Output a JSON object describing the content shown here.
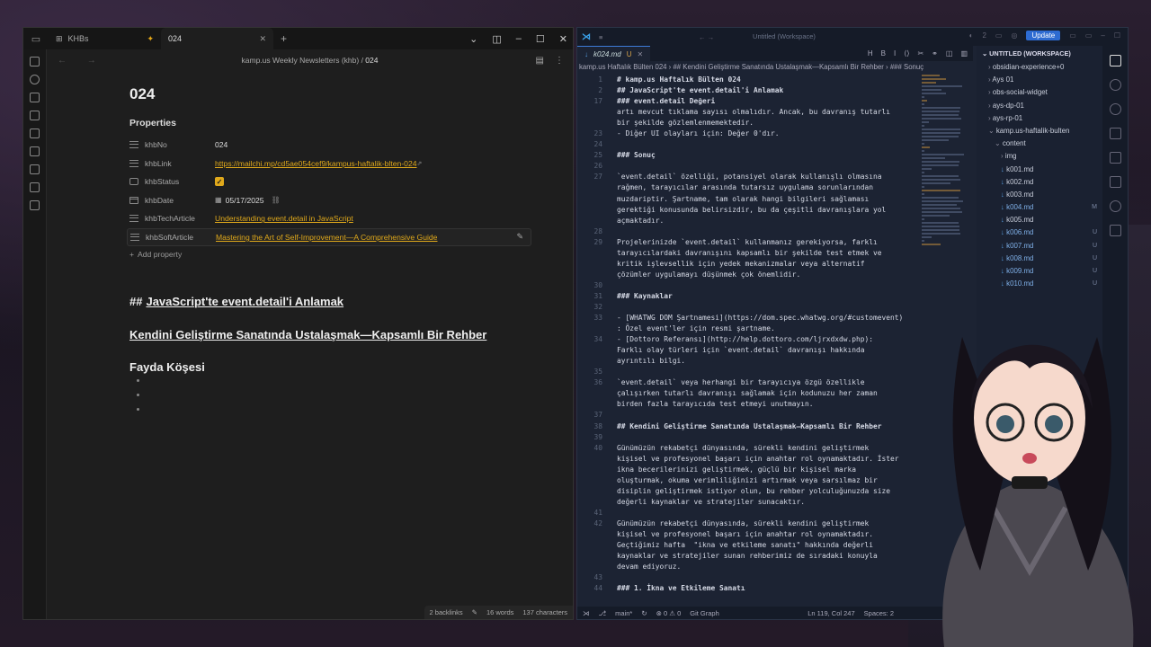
{
  "obsidian": {
    "tabs": [
      {
        "label": "KHBs",
        "icon": "grid-icon"
      },
      {
        "label": "024",
        "icon": "pin-icon"
      }
    ],
    "breadcrumb": {
      "path": "kamp.us Weekly Newsletters (khb)",
      "sep": " / ",
      "current": "024"
    },
    "note": {
      "title": "024",
      "properties_title": "Properties",
      "properties": [
        {
          "key": "khbNo",
          "value": "024",
          "type": "text"
        },
        {
          "key": "khbLink",
          "value": "https://mailchi.mp/cd5ae054cef9/kampus-haftalik-blten-024",
          "type": "link"
        },
        {
          "key": "khbStatus",
          "value": "checked",
          "type": "checkbox"
        },
        {
          "key": "khbDate",
          "value": "05/17/2025",
          "type": "date"
        },
        {
          "key": "khbTechArticle",
          "value": "Understanding event.detail in JavaScript",
          "type": "link"
        },
        {
          "key": "khbSoftArticle",
          "value": "Mastering the Art of Self-Improvement—A Comprehensive Guide",
          "type": "link"
        }
      ],
      "add_property": "Add property",
      "heading1_hash": "##",
      "heading1": "JavaScript'te event.detail'i Anlamak",
      "heading2": "Kendini Geliştirme Sanatında Ustalaşmak—Kapsamlı Bir Rehber",
      "heading3": "Fayda Köşesi"
    },
    "status": {
      "backlinks": "2 backlinks",
      "words": "16 words",
      "chars": "137 characters"
    }
  },
  "vscode": {
    "title": "Untitled (Workspace)",
    "tab": {
      "name": "k024.md",
      "flag": "U"
    },
    "breadcrumb": "kamp.us Haftalık Bülten 024 › ## Kendini Geliştirme Sanatında Ustalaşmak—Kapsamlı Bir Rehber › ### Sonuç",
    "update_label": "Update",
    "notif_count": "2",
    "explorer": {
      "header": "UNTITLED (WORKSPACE)",
      "items": [
        {
          "label": "obsidian-experience+0",
          "badge": ""
        },
        {
          "label": "Ays 01",
          "badge": ""
        },
        {
          "label": "obs-social-widget",
          "badge": ""
        },
        {
          "label": "ays-dp-01",
          "badge": ""
        },
        {
          "label": "ays-rp-01",
          "badge": ""
        },
        {
          "label": "kamp.us-haftalik-bulten",
          "badge": ""
        },
        {
          "label": "content",
          "badge": ""
        },
        {
          "label": "img",
          "badge": ""
        },
        {
          "label": "k001.md",
          "badge": ""
        },
        {
          "label": "k002.md",
          "badge": ""
        },
        {
          "label": "k003.md",
          "badge": ""
        },
        {
          "label": "k004.md",
          "badge": "M"
        },
        {
          "label": "k005.md",
          "badge": ""
        },
        {
          "label": "k006.md",
          "badge": "U"
        },
        {
          "label": "k007.md",
          "badge": "U"
        },
        {
          "label": "k008.md",
          "badge": "U"
        },
        {
          "label": "k009.md",
          "badge": "U"
        },
        {
          "label": "k010.md",
          "badge": "U"
        }
      ]
    },
    "status": {
      "branch": "main*",
      "problems": "⊗ 0 ⚠ 0",
      "git": "Git Graph",
      "position": "Ln 119, Col 247",
      "spaces": "Spaces: 2"
    },
    "code_lines": [
      {
        "n": "1",
        "t": "# kamp.us Haftalık Bülten 024",
        "c": "c-h"
      },
      {
        "n": "2",
        "t": "## JavaScript'te event.detail'i Anlamak",
        "c": "c-h2"
      },
      {
        "n": "17",
        "t": "### event.detail Değeri",
        "c": "c-h2"
      },
      {
        "n": "",
        "t": "artı mevcut tıklama sayısı olmalıdır. Ancak, bu davranış tutarlı",
        "c": ""
      },
      {
        "n": "",
        "t": "bir şekilde gözlemlenmemektedir.",
        "c": ""
      },
      {
        "n": "23",
        "t": "- Diğer UI olayları için: Değer 0'dır.",
        "c": ""
      },
      {
        "n": "24",
        "t": "",
        "c": ""
      },
      {
        "n": "25",
        "t": "### Sonuç",
        "c": "c-h2"
      },
      {
        "n": "26",
        "t": "",
        "c": ""
      },
      {
        "n": "27",
        "t": "`event.detail` özelliği, potansiyel olarak kullanışlı olmasına",
        "c": ""
      },
      {
        "n": "",
        "t": "rağmen, tarayıcılar arasında tutarsız uygulama sorunlarından",
        "c": ""
      },
      {
        "n": "",
        "t": "muzdariptir. Şartname, tam olarak hangi bilgileri sağlaması",
        "c": ""
      },
      {
        "n": "",
        "t": "gerektiği konusunda belirsizdir, bu da çeşitli davranışlara yol",
        "c": ""
      },
      {
        "n": "",
        "t": "açmaktadır.",
        "c": ""
      },
      {
        "n": "28",
        "t": "",
        "c": ""
      },
      {
        "n": "29",
        "t": "Projelerinizde `event.detail` kullanmanız gerekiyorsa, farklı",
        "c": ""
      },
      {
        "n": "",
        "t": "tarayıcılardaki davranışını kapsamlı bir şekilde test etmek ve",
        "c": ""
      },
      {
        "n": "",
        "t": "kritik işlevsellik için yedek mekanizmalar veya alternatif",
        "c": ""
      },
      {
        "n": "",
        "t": "çözümler uygulamayı düşünmek çok önemlidir.",
        "c": ""
      },
      {
        "n": "30",
        "t": "",
        "c": ""
      },
      {
        "n": "31",
        "t": "### Kaynaklar",
        "c": "c-h2"
      },
      {
        "n": "32",
        "t": "",
        "c": ""
      },
      {
        "n": "33",
        "t": "- [WHATWG DOM Şartnamesi](https://dom.spec.whatwg.org/#customevent)",
        "c": ""
      },
      {
        "n": "",
        "t": ": Özel event'ler için resmi şartname.",
        "c": ""
      },
      {
        "n": "34",
        "t": "- [Dottoro Referansı](http://help.dottoro.com/ljrxdxdw.php):",
        "c": ""
      },
      {
        "n": "",
        "t": "Farklı olay türleri için `event.detail` davranışı hakkında",
        "c": ""
      },
      {
        "n": "",
        "t": "ayrıntılı bilgi.",
        "c": ""
      },
      {
        "n": "35",
        "t": "",
        "c": ""
      },
      {
        "n": "36",
        "t": "`event.detail` veya herhangi bir tarayıcıya özgü özellikle",
        "c": ""
      },
      {
        "n": "",
        "t": "çalışırken tutarlı davranışı sağlamak için kodunuzu her zaman",
        "c": ""
      },
      {
        "n": "",
        "t": "birden fazla tarayıcıda test etmeyi unutmayın.",
        "c": ""
      },
      {
        "n": "37",
        "t": "",
        "c": ""
      },
      {
        "n": "38",
        "t": "## Kendini Geliştirme Sanatında Ustalaşmak—Kapsamlı Bir Rehber",
        "c": "c-h2"
      },
      {
        "n": "39",
        "t": "",
        "c": ""
      },
      {
        "n": "40",
        "t": "Günümüzün rekabetçi dünyasında, sürekli kendini geliştirmek",
        "c": ""
      },
      {
        "n": "",
        "t": "kişisel ve profesyonel başarı için anahtar rol oynamaktadır. İster",
        "c": ""
      },
      {
        "n": "",
        "t": "ikna becerilerinizi geliştirmek, güçlü bir kişisel marka",
        "c": ""
      },
      {
        "n": "",
        "t": "oluşturmak, okuma verimliliğinizi artırmak veya sarsılmaz bir",
        "c": ""
      },
      {
        "n": "",
        "t": "disiplin geliştirmek istiyor olun, bu rehber yolculuğunuzda size",
        "c": ""
      },
      {
        "n": "",
        "t": "değerli kaynaklar ve stratejiler sunacaktır.",
        "c": ""
      },
      {
        "n": "41",
        "t": "",
        "c": ""
      },
      {
        "n": "42",
        "t": "Günümüzün rekabetçi dünyasında, sürekli kendini geliştirmek",
        "c": ""
      },
      {
        "n": "",
        "t": "kişisel ve profesyonel başarı için anahtar rol oynamaktadır.",
        "c": ""
      },
      {
        "n": "",
        "t": "Geçtiğimiz hafta  \"ikna ve etkileme sanatı\" hakkında değerli",
        "c": ""
      },
      {
        "n": "",
        "t": "kaynaklar ve stratejiler sunan rehberimiz de sıradaki konuyla",
        "c": ""
      },
      {
        "n": "",
        "t": "devam ediyoruz.",
        "c": ""
      },
      {
        "n": "43",
        "t": "",
        "c": ""
      },
      {
        "n": "44",
        "t": "### 1. İkna ve Etkileme Sanatı",
        "c": "c-h2"
      }
    ]
  }
}
